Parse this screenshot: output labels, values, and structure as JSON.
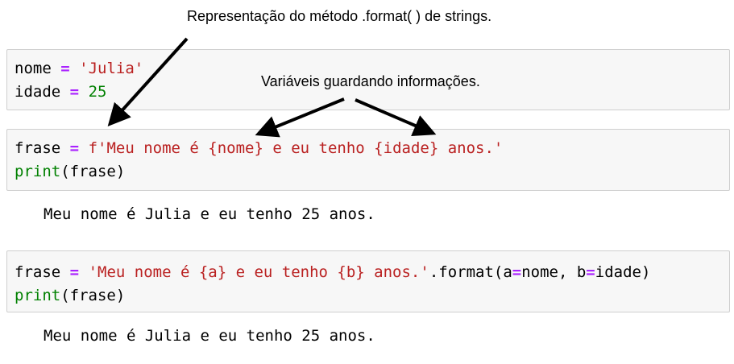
{
  "annotations": {
    "format_method": "Representação do método .format( ) de strings.",
    "variables": "Variáveis guardando informações."
  },
  "cell1": {
    "line1": {
      "var": "nome",
      "op": "=",
      "value": "'Julia'"
    },
    "line2": {
      "var": "idade",
      "op": "=",
      "value": "25"
    }
  },
  "cell2": {
    "line1": {
      "var": "frase",
      "op": "=",
      "fprefix": "f",
      "fstring": "'Meu nome é {nome} e eu tenho {idade} anos.'"
    },
    "line2": {
      "func": "print",
      "arg": "(frase)"
    },
    "output": "Meu nome é Julia e eu tenho 25 anos."
  },
  "cell3": {
    "line1": {
      "var": "frase",
      "op": "=",
      "string": "'Meu nome é {a} e eu tenho {b} anos.'",
      "call_start": ".format(a",
      "op2": "=",
      "call_mid": "nome, b",
      "op3": "=",
      "call_end": "idade)"
    },
    "line2": {
      "func": "print",
      "arg": "(frase)"
    },
    "output": "Meu nome é Julia e eu tenho 25 anos."
  },
  "colors": {
    "operator": "#aa22ff",
    "string": "#ba2121",
    "number": "#008000",
    "builtin": "#008000",
    "cell_bg": "#f7f7f7",
    "cell_border": "#cfcfcf"
  }
}
